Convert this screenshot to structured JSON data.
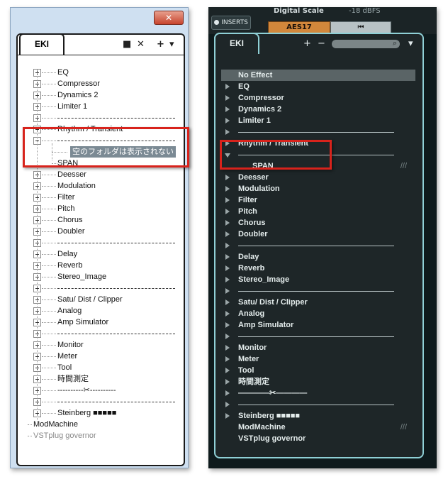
{
  "left": {
    "close_label": "✕",
    "tab_label": "EKI",
    "tools": {
      "folder": "■",
      "close": "✕",
      "add": "+",
      "menu": "▾"
    },
    "items": [
      {
        "type": "item",
        "label": "EQ",
        "expander": "plus"
      },
      {
        "type": "item",
        "label": "Compressor",
        "expander": "plus"
      },
      {
        "type": "item",
        "label": "Dynamics 2",
        "expander": "plus"
      },
      {
        "type": "item",
        "label": "Limiter 1",
        "expander": "plus"
      },
      {
        "type": "sep",
        "expander": "plus"
      },
      {
        "type": "item",
        "label": "Rhythm / Transient",
        "expander": "plus"
      },
      {
        "type": "sep",
        "expander": "minus"
      },
      {
        "type": "highlight",
        "label": "空のフォルダは表示されない"
      },
      {
        "type": "child",
        "label": "SPAN"
      },
      {
        "type": "item",
        "label": "Deesser",
        "expander": "plus"
      },
      {
        "type": "item",
        "label": "Modulation",
        "expander": "plus"
      },
      {
        "type": "item",
        "label": "Filter",
        "expander": "plus"
      },
      {
        "type": "item",
        "label": "Pitch",
        "expander": "plus"
      },
      {
        "type": "item",
        "label": "Chorus",
        "expander": "plus"
      },
      {
        "type": "item",
        "label": "Doubler",
        "expander": "plus"
      },
      {
        "type": "sep",
        "expander": "plus"
      },
      {
        "type": "item",
        "label": "Delay",
        "expander": "plus"
      },
      {
        "type": "item",
        "label": "Reverb",
        "expander": "plus"
      },
      {
        "type": "item",
        "label": "Stereo_Image",
        "expander": "plus"
      },
      {
        "type": "sep",
        "expander": "plus"
      },
      {
        "type": "item",
        "label": "Satu/ Dist / Clipper",
        "expander": "plus"
      },
      {
        "type": "item",
        "label": "Analog",
        "expander": "plus"
      },
      {
        "type": "item",
        "label": "Amp Simulator",
        "expander": "plus"
      },
      {
        "type": "sep",
        "expander": "plus"
      },
      {
        "type": "item",
        "label": "Monitor",
        "expander": "plus"
      },
      {
        "type": "item",
        "label": "Meter",
        "expander": "plus"
      },
      {
        "type": "item",
        "label": "Tool",
        "expander": "plus"
      },
      {
        "type": "item",
        "label": "時間測定",
        "expander": "plus"
      },
      {
        "type": "item",
        "label": "----------✂----------",
        "expander": "plus"
      },
      {
        "type": "sep",
        "expander": "plus"
      },
      {
        "type": "item",
        "label": "Steinberg ■■■■■",
        "expander": "plus"
      },
      {
        "type": "leaf",
        "label": "ModMachine"
      },
      {
        "type": "leaf-gray",
        "label": "VSTplug governor"
      }
    ]
  },
  "right": {
    "top": {
      "inserts_label": "INSERTS",
      "digital_scale_label": "Digital Scale",
      "digital_scale_value": "-18 dBFS",
      "aes_label": "AES17",
      "rewind_label": "⏮"
    },
    "tab_label": "EKI",
    "tools": {
      "add": "+",
      "remove": "−",
      "search": "⌕",
      "menu": "▾"
    },
    "items": [
      {
        "type": "noeffect",
        "label": "No Effect"
      },
      {
        "type": "item",
        "label": "EQ"
      },
      {
        "type": "item",
        "label": "Compressor"
      },
      {
        "type": "item",
        "label": "Dynamics 2"
      },
      {
        "type": "item",
        "label": "Limiter 1"
      },
      {
        "type": "sep"
      },
      {
        "type": "item",
        "label": "Rhythm / Transient"
      },
      {
        "type": "sep-open"
      },
      {
        "type": "child",
        "label": "SPAN",
        "slash": "///"
      },
      {
        "type": "item",
        "label": "Deesser"
      },
      {
        "type": "item",
        "label": "Modulation"
      },
      {
        "type": "item",
        "label": "Filter"
      },
      {
        "type": "item",
        "label": "Pitch"
      },
      {
        "type": "item",
        "label": "Chorus"
      },
      {
        "type": "item",
        "label": "Doubler"
      },
      {
        "type": "sep"
      },
      {
        "type": "item",
        "label": "Delay"
      },
      {
        "type": "item",
        "label": "Reverb"
      },
      {
        "type": "item",
        "label": "Stereo_Image"
      },
      {
        "type": "sep"
      },
      {
        "type": "item",
        "label": "Satu/ Dist / Clipper"
      },
      {
        "type": "item",
        "label": "Analog"
      },
      {
        "type": "item",
        "label": "Amp Simulator"
      },
      {
        "type": "sep"
      },
      {
        "type": "item",
        "label": "Monitor"
      },
      {
        "type": "item",
        "label": "Meter"
      },
      {
        "type": "item",
        "label": "Tool"
      },
      {
        "type": "item",
        "label": "時間測定"
      },
      {
        "type": "item",
        "label": "————✂————"
      },
      {
        "type": "sep"
      },
      {
        "type": "item",
        "label": "Steinberg ■■■■■"
      },
      {
        "type": "leaf",
        "label": "ModMachine",
        "slash": "///"
      },
      {
        "type": "leaf",
        "label": "VSTplug governor"
      }
    ]
  },
  "colors": {
    "highlight_red": "#d8231c",
    "dark_border": "#8fd0d6",
    "aes_orange": "#d2873b"
  }
}
